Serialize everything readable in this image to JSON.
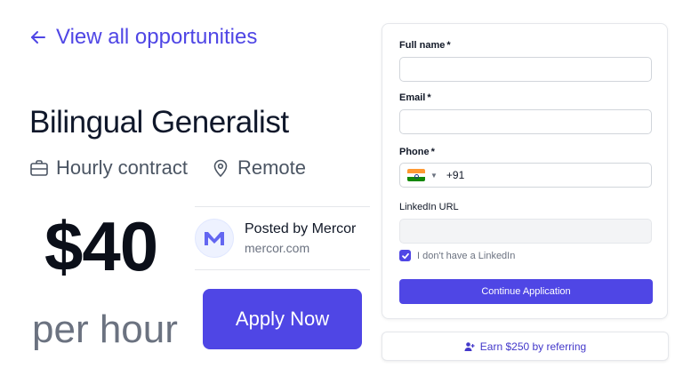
{
  "nav": {
    "back_label": "View all opportunities",
    "back_icon": "arrow-left-icon"
  },
  "job": {
    "title": "Bilingual Generalist",
    "contract_type": "Hourly contract",
    "location": "Remote",
    "price": "$40",
    "rate_unit": "per hour"
  },
  "poster": {
    "posted_by": "Posted by Mercor",
    "domain": "mercor.com",
    "logo_letter": "M"
  },
  "apply_button": "Apply Now",
  "form": {
    "full_name_label": "Full name",
    "email_label": "Email",
    "phone_label": "Phone",
    "required_marker": "*",
    "phone_country_code": "+91",
    "phone_country_flag": "flag-india-icon",
    "linkedin_label": "LinkedIn URL",
    "no_linkedin_label": "I don't have a LinkedIn",
    "no_linkedin_checked": true,
    "continue_label": "Continue Application",
    "full_name_value": "",
    "email_value": "",
    "phone_value": "",
    "linkedin_value": ""
  },
  "referral": {
    "label": "Earn $250 by referring",
    "icon": "user-plus-icon"
  },
  "colors": {
    "accent": "#4f46e5",
    "text": "#111827",
    "muted": "#6b7280"
  }
}
